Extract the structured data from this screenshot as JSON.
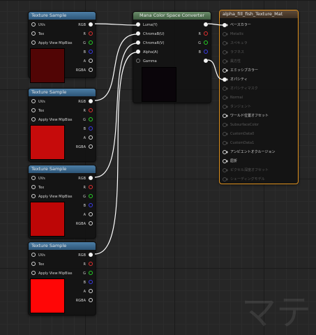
{
  "texture_nodes": [
    {
      "title": "Texture Sample",
      "preview_color": "#510505",
      "inputs": [
        "UVs",
        "Tex",
        "Apply View MipBias"
      ],
      "outputs": [
        "RGB",
        "R",
        "G",
        "B",
        "A",
        "RGBA"
      ]
    },
    {
      "title": "Texture Sample",
      "preview_color": "#c60b0b",
      "inputs": [
        "UVs",
        "Tex",
        "Apply View MipBias"
      ],
      "outputs": [
        "RGB",
        "R",
        "G",
        "B",
        "A",
        "RGBA"
      ]
    },
    {
      "title": "Texture Sample",
      "preview_color": "#bd0606",
      "inputs": [
        "UVs",
        "Tex",
        "Apply View MipBias"
      ],
      "outputs": [
        "RGB",
        "R",
        "G",
        "B",
        "A",
        "RGBA"
      ]
    },
    {
      "title": "Texture Sample",
      "preview_color": "#ff0606",
      "inputs": [
        "UVs",
        "Tex",
        "Apply View MipBias"
      ],
      "outputs": [
        "RGB",
        "R",
        "G",
        "B",
        "A",
        "RGBA"
      ]
    }
  ],
  "converter": {
    "title": "Mana Color Space Converter",
    "preview_color": "#0a050a",
    "inputs": [
      "Luma(Y)",
      "ChromaB(U)",
      "ChromaR(V)",
      "Alpha(A)",
      "Gamma"
    ],
    "outputs": [
      "",
      "R",
      "G",
      "B",
      ""
    ]
  },
  "material": {
    "title": "alpha_fill_fish_Texture_Mat",
    "inputs": [
      {
        "label": "ベースカラー",
        "enabled": true,
        "connected": true
      },
      {
        "label": "Metallic",
        "enabled": false
      },
      {
        "label": "スペキュラ",
        "enabled": false
      },
      {
        "label": "ラフネス",
        "enabled": false
      },
      {
        "label": "異方性",
        "enabled": false
      },
      {
        "label": "エミッシブカラー",
        "enabled": true,
        "connected": false
      },
      {
        "label": "オパシティ",
        "enabled": true,
        "connected": true
      },
      {
        "label": "オパシティマスク",
        "enabled": false
      },
      {
        "label": "Normal",
        "enabled": false
      },
      {
        "label": "タンジェント",
        "enabled": false
      },
      {
        "label": "ワールド位置オフセット",
        "enabled": true,
        "connected": false
      },
      {
        "label": "SubsurfaceColor",
        "enabled": false
      },
      {
        "label": "CustomData0",
        "enabled": false
      },
      {
        "label": "CustomData1",
        "enabled": false
      },
      {
        "label": "アンビエントオクルージョン",
        "enabled": true,
        "connected": false
      },
      {
        "label": "屈折",
        "enabled": true,
        "connected": false
      },
      {
        "label": "ピクセル深度オフセット",
        "enabled": false
      },
      {
        "label": "シェーディングモデル",
        "enabled": false
      }
    ]
  },
  "watermark": "マテ",
  "colors": {
    "texture_header": "#3a6a90",
    "converter_header": "#557555",
    "material_border": "#e0921f",
    "wire": "#ffffff"
  }
}
